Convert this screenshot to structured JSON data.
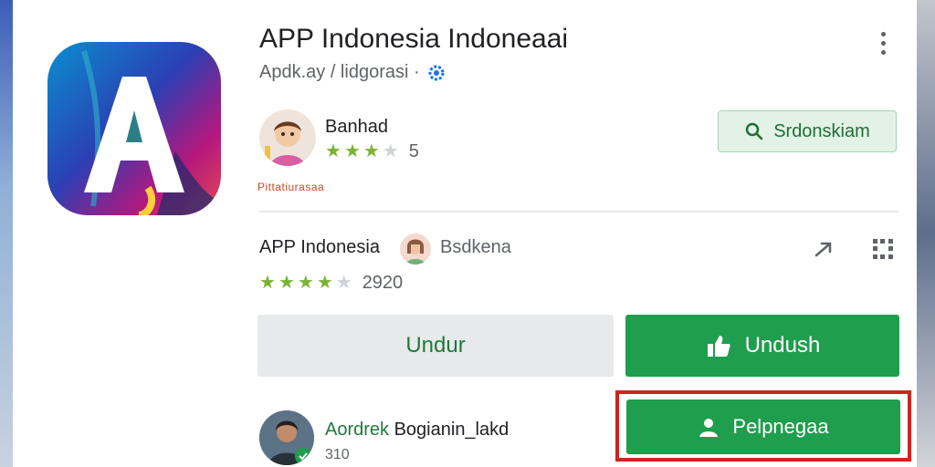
{
  "app": {
    "title": "APP Indonesia Indoneaai",
    "subtitle": "Apdk.ay / lidgorasi ·"
  },
  "developer": {
    "name": "Banhad",
    "rating": 3,
    "rating_max": 5,
    "count": "5",
    "tag": "Pittatiurasaa"
  },
  "search_button": {
    "label": "Srdonskiam",
    "icon": "search-icon"
  },
  "listing": {
    "name": "APP Indonesia",
    "author": "Bsdkena",
    "rating": 4,
    "rating_max": 5,
    "count": "2920"
  },
  "buttons": {
    "secondary_label": "Undur",
    "primary_label": "Undush",
    "register_label": "Pelpnegaa"
  },
  "reviewer": {
    "name_highlight": "Aordrek",
    "name_rest": "Bogianin_lakd",
    "number": "310"
  },
  "colors": {
    "accent_green": "#1f9e4d",
    "star_green": "#7ab335",
    "highlight_red": "#d4221f"
  }
}
